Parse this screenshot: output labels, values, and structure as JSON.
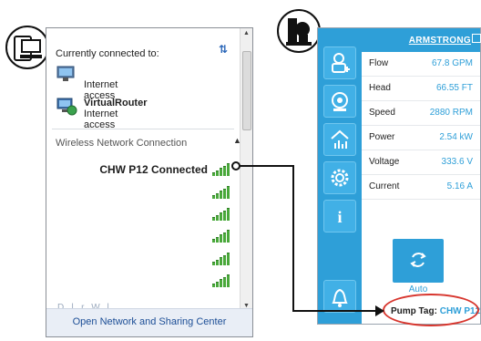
{
  "flyout": {
    "header": "Currently connected to:",
    "connections": [
      {
        "name": "",
        "status": "Internet access"
      },
      {
        "name": "VirtualRouter",
        "status": "Internet access"
      }
    ],
    "section_title": "Wireless Network Connection",
    "networks": [
      {
        "label": "CHW P12 Connected",
        "bars": 5
      },
      {
        "label": "",
        "bars": 5
      },
      {
        "label": "",
        "bars": 5
      },
      {
        "label": "",
        "bars": 5
      },
      {
        "label": "",
        "bars": 5
      },
      {
        "label": "",
        "bars": 5
      }
    ],
    "faded_item": "D...l...r...W...l",
    "footer_link": "Open Network and Sharing Center"
  },
  "app": {
    "brand": "ARMSTRONG",
    "rows": [
      {
        "key": "Flow",
        "value": "67.8 GPM"
      },
      {
        "key": "Head",
        "value": "66.55 FT"
      },
      {
        "key": "Speed",
        "value": "2880 RPM"
      },
      {
        "key": "Power",
        "value": "2.54 kW"
      },
      {
        "key": "Voltage",
        "value": "333.6 V"
      },
      {
        "key": "Current",
        "value": "5.16 A"
      }
    ],
    "auto_label": "Auto",
    "pump_tag_label": "Pump Tag:",
    "pump_tag_value": "CHW P12"
  },
  "colors": {
    "accent": "#2e9fd8",
    "signal": "#49a83a",
    "callout": "#d7362e"
  },
  "icons": {
    "computer_badge": "computer-network-icon",
    "pump_badge": "pump-icon"
  }
}
